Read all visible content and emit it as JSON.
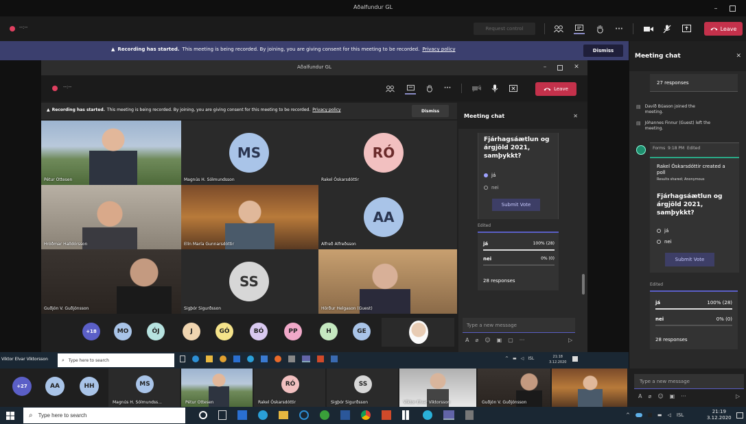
{
  "outer": {
    "title": "Aðalfundur GL",
    "timer": "--:--",
    "request_control": "Request control",
    "leave": "Leave",
    "banner": {
      "bold": "Recording has started.",
      "text": "This meeting is being recorded. By joining, you are giving consent for this meeting to be recorded.",
      "link": "Privacy policy",
      "dismiss": "Dismiss"
    }
  },
  "inner": {
    "title": "Aðalfundur GL",
    "timer": "--:--",
    "leave": "Leave",
    "banner": {
      "bold": "Recording has started.",
      "text": "This meeting is being recorded. By joining, you are giving consent for this meeting to be recorded.",
      "link": "Privacy policy",
      "dismiss": "Dismiss"
    },
    "tiles": [
      {
        "name": "Pétur Ottesen",
        "initials": "",
        "color": ""
      },
      {
        "name": "Magnús H. Sólmundsson",
        "initials": "MS",
        "color": "#a9c4e8"
      },
      {
        "name": "Rakel Óskarsdóttir",
        "initials": "RÓ",
        "color": "#f2c0c0"
      },
      {
        "name": "Hróðmar Halldórsson",
        "initials": "",
        "color": ""
      },
      {
        "name": "Elín María Gunnarsdóttir",
        "initials": "",
        "color": ""
      },
      {
        "name": "Alfreð Alfreðsson",
        "initials": "AA",
        "color": "#a9c4e8"
      },
      {
        "name": "Guðjón V. Guðjónsson",
        "initials": "",
        "color": ""
      },
      {
        "name": "Sigþór Sigurðsson",
        "initials": "SS",
        "color": "#d7d7d7"
      },
      {
        "name": "Hörður Helgason (Guest)",
        "initials": "",
        "color": ""
      }
    ],
    "roster": [
      {
        "initials": "+18",
        "color": "#5b5fc7"
      },
      {
        "initials": "MO",
        "color": "#a9c4e8"
      },
      {
        "initials": "ÓJ",
        "color": "#b7e3e0"
      },
      {
        "initials": "J",
        "color": "#f0d5b0"
      },
      {
        "initials": "GÓ",
        "color": "#f5e38a"
      },
      {
        "initials": "BÓ",
        "color": "#d9c9f0"
      },
      {
        "initials": "PP",
        "color": "#f0a8c8"
      },
      {
        "initials": "H",
        "color": "#c5e8c0"
      },
      {
        "initials": "GE",
        "color": "#a9c4e8"
      }
    ],
    "chat": {
      "title": "Meeting chat",
      "poll_question": "Fjárhagsáætlun og árgjöld 2021, samþykkt?",
      "options": [
        "já",
        "nei"
      ],
      "submit": "Submit Vote",
      "edited": "Edited",
      "results": [
        {
          "label": "já",
          "value": "100% (28)",
          "fraction": 1.0
        },
        {
          "label": "nei",
          "value": "0% (0)",
          "fraction": 0.0
        }
      ],
      "responses": "28 responses",
      "compose_placeholder": "Type a new message"
    }
  },
  "right_chat": {
    "title": "Meeting chat",
    "prev_responses": "27 responses",
    "events": [
      "Davíð Búason joined the meeting.",
      "Jóhannes Finnur (Guest) left the meeting."
    ],
    "forms_header": "Forms  9:18 PM  Edited",
    "poll_intro": "Rakel Óskarsdóttir created a poll",
    "poll_meta": "Results shared; Anonymous",
    "poll_question": "Fjárhagsáætlun og árgjöld 2021, samþykkt?",
    "options": [
      "já",
      "nei"
    ],
    "submit": "Submit Vote",
    "edited": "Edited",
    "results": [
      {
        "label": "já",
        "value": "100% (28)",
        "fraction": 1.0
      },
      {
        "label": "nei",
        "value": "0% (0)",
        "fraction": 0.0
      }
    ],
    "responses": "28 responses",
    "compose_placeholder": "Type a new message"
  },
  "inner_taskbar": {
    "user": "Viktor Elvar Viktorsson",
    "search": "Type here to search",
    "lang": "ISL",
    "time": "21:18",
    "date": "3.12.2020"
  },
  "bottom_strip": [
    {
      "type": "pill",
      "initials": "+27",
      "color": "#5b5fc7"
    },
    {
      "type": "pill",
      "initials": "AA",
      "color": "#a9c4e8"
    },
    {
      "type": "pill",
      "initials": "HH",
      "color": "#a9c4e8"
    },
    {
      "type": "tile",
      "initials": "MS",
      "name": "Magnús H. Sólmundss...",
      "color": "#a9c4e8"
    },
    {
      "type": "video",
      "initials": "",
      "name": "Pétur Ottesen",
      "color": ""
    },
    {
      "type": "tile",
      "initials": "RÓ",
      "name": "Rakel Óskarsdóttir",
      "color": "#f2c0c0"
    },
    {
      "type": "tile",
      "initials": "SS",
      "name": "Sigþór Sigurðsson",
      "color": "#d7d7d7"
    },
    {
      "type": "video",
      "initials": "",
      "name": "Viktor Elvar Viktorsson",
      "color": ""
    },
    {
      "type": "video",
      "initials": "",
      "name": "Guðjón V. Guðjónsson",
      "color": ""
    },
    {
      "type": "video",
      "initials": "",
      "name": "",
      "color": ""
    }
  ],
  "taskbar": {
    "search": "Type here to search",
    "lang": "ISL",
    "time": "21:19",
    "date": "3.12.2020"
  },
  "colors": {
    "leave": "#c4314b",
    "accent": "#6264a7",
    "banner": "#3b3f6e"
  }
}
